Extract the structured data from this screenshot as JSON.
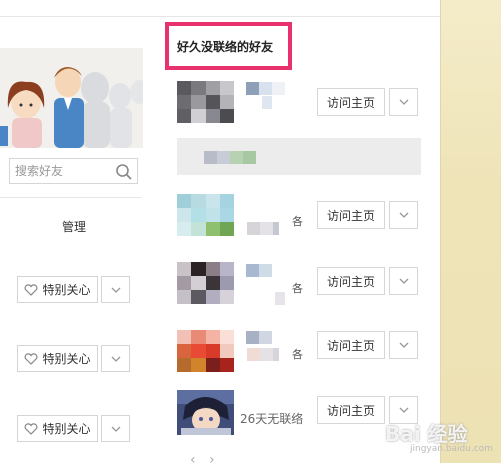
{
  "friends_panel": {
    "title": "好久没联络的好友",
    "visit_label": "访问主页",
    "inactive_status": "26天无联络"
  },
  "sidebar": {
    "search_placeholder": "搜索好友",
    "manage_label": "管理",
    "care_label": "特别关心"
  },
  "row_tail": "各",
  "watermark": {
    "text": "Bai 经验",
    "sub": "jingyan.baidu.com"
  },
  "colors": {
    "highlight": "#e8326d"
  }
}
